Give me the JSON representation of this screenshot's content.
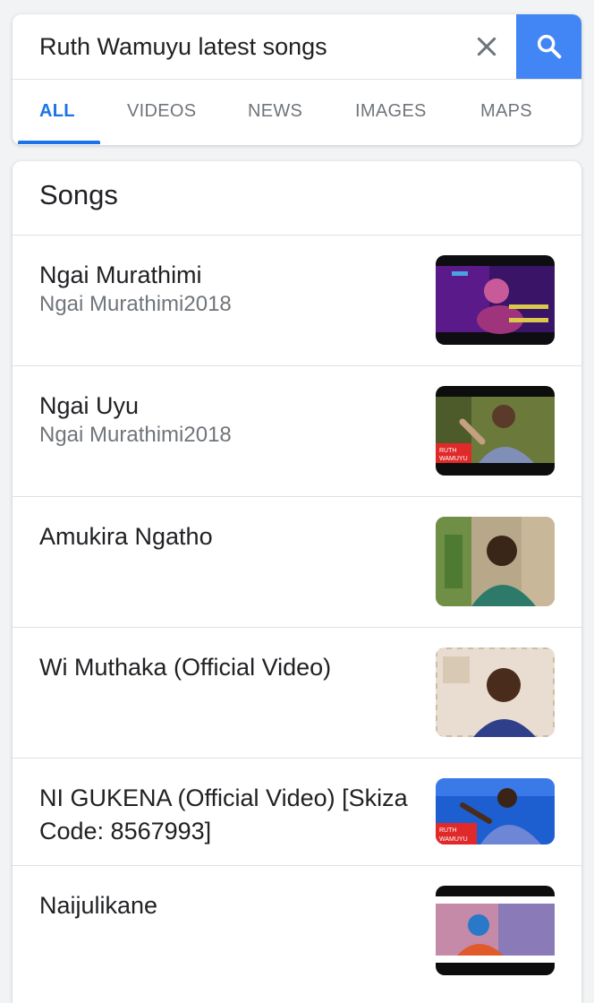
{
  "search": {
    "query": "Ruth Wamuyu latest songs",
    "clear_icon": "close-icon",
    "search_icon": "search-icon",
    "accent": "#4285f4"
  },
  "tabs": [
    {
      "label": "ALL",
      "active": true
    },
    {
      "label": "VIDEOS",
      "active": false
    },
    {
      "label": "NEWS",
      "active": false
    },
    {
      "label": "IMAGES",
      "active": false
    },
    {
      "label": "MAPS",
      "active": false
    }
  ],
  "songs": {
    "header": "Songs",
    "items": [
      {
        "title": "Ngai Murathimi",
        "subtitle": "Ngai Murathimi2018"
      },
      {
        "title": "Ngai Uyu",
        "subtitle": "Ngai Murathimi2018"
      },
      {
        "title": "Amukira Ngatho",
        "subtitle": ""
      },
      {
        "title": "Wi Muthaka (Official Video)",
        "subtitle": ""
      },
      {
        "title": "NI GUKENA (Official Video) [Skiza Code: 8567993]",
        "subtitle": ""
      },
      {
        "title": "Naijulikane",
        "subtitle": ""
      }
    ],
    "thumb_captions": {
      "thumb_2": "RUTH WAMUYU",
      "thumb_5": "RUTH WAMUYU"
    }
  }
}
